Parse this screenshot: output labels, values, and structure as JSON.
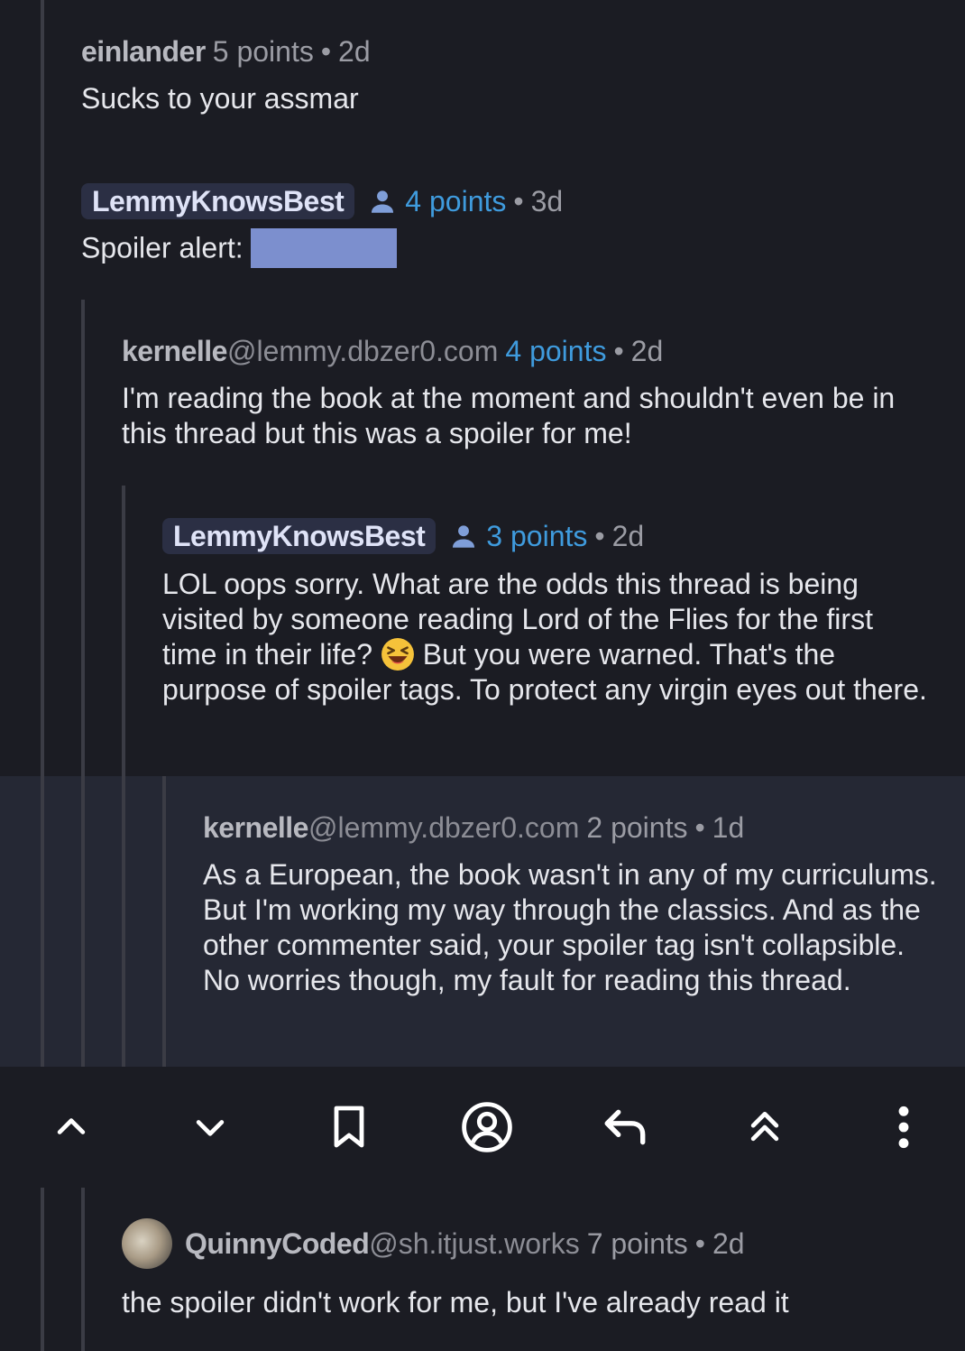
{
  "comments": [
    {
      "author": "einlander",
      "instance": "",
      "points": "5 points",
      "sep": "•",
      "age": "2d",
      "body": "Sucks to your assmar"
    },
    {
      "author": "LemmyKnowsBest",
      "instance": "",
      "points": "4 points",
      "sep": "•",
      "age": "3d",
      "body": "Spoiler alert:",
      "is_op": true
    },
    {
      "author": "kernelle",
      "instance": "@lemmy.dbzer0.com",
      "points": "4 points",
      "sep": "•",
      "age": "2d",
      "body": "I'm reading the book at the moment and shouldn't even be in this thread but this was a spoiler for me!"
    },
    {
      "author": "LemmyKnowsBest",
      "instance": "",
      "points": "3 points",
      "sep": "•",
      "age": "2d",
      "body_before_emoji": "LOL oops sorry. What are the odds this thread is being visited by someone reading Lord of the Flies for the first time in their life?",
      "emoji": "laughing-emoji",
      "body_after_emoji": "But you were warned. That's the purpose of spoiler tags. To protect any virgin eyes out there.",
      "is_op": true
    },
    {
      "author": "kernelle",
      "instance": "@lemmy.dbzer0.com",
      "points": "2 points",
      "sep": "•",
      "age": "1d",
      "body": "As a European, the book wasn't in any of my curriculums. But I'm working my way through the classics. And as the other commenter said, your spoiler tag isn't collapsible. No worries though, my fault for reading this thread.",
      "selected": true
    },
    {
      "author": "QuinnyCoded",
      "instance": "@sh.itjust.works",
      "points": "7 points",
      "sep": "•",
      "age": "2d",
      "body": "the spoiler didn't work for me, but I've already read it",
      "has_avatar": true
    }
  ],
  "action_bar": {
    "icons": [
      "upvote-icon",
      "downvote-icon",
      "bookmark-icon",
      "user-profile-icon",
      "reply-icon",
      "collapse-thread-icon",
      "more-options-icon"
    ]
  },
  "colors": {
    "background": "#1b1c23",
    "selected_background": "#252834",
    "accent_points": "#3f9bdd",
    "op_badge": "#2b2f44",
    "spoiler_block": "#7c8fce"
  }
}
